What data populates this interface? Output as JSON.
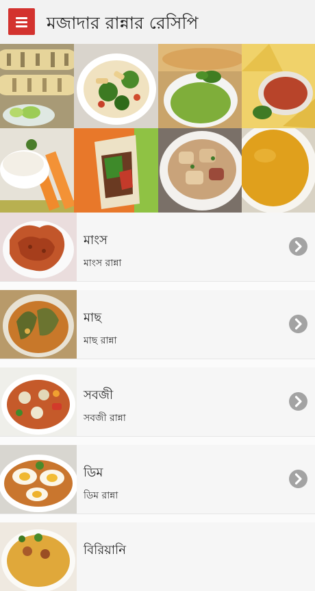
{
  "app_bar": {
    "title": "মজাদার রান্নার রেসিপি",
    "menu_icon": "hamburger-menu-icon",
    "accent_color": "#d3322e"
  },
  "categories": [
    {
      "name": "মাংস",
      "subtitle": "মাংস রান্না"
    },
    {
      "name": "মাছ",
      "subtitle": "মাছ রান্না"
    },
    {
      "name": "সবজী",
      "subtitle": "সবজী রান্না"
    },
    {
      "name": "ডিম",
      "subtitle": "ডিম রান্না"
    },
    {
      "name": "বিরিয়ানি",
      "subtitle": ""
    }
  ],
  "row_action_icon": "chevron-right-circle-icon"
}
